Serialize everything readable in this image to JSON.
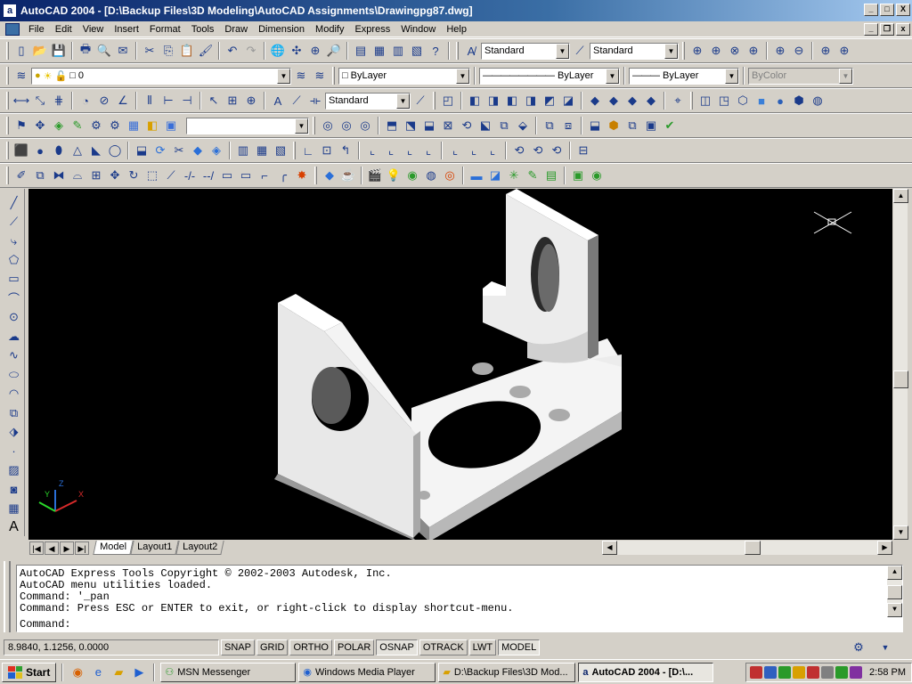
{
  "window": {
    "title": "AutoCAD 2004 - [D:\\Backup Files\\3D Modeling\\AutoCAD Assignments\\Drawingpg87.dwg]",
    "controls": [
      "_",
      "□",
      "X"
    ]
  },
  "menubar": {
    "items": [
      "File",
      "Edit",
      "View",
      "Insert",
      "Format",
      "Tools",
      "Draw",
      "Dimension",
      "Modify",
      "Express",
      "Window",
      "Help"
    ]
  },
  "toolbars": {
    "text_style": "Standard",
    "dim_style": "Standard",
    "layer": "0",
    "color": "ByLayer",
    "linetype": "ByLayer",
    "lineweight": "ByLayer",
    "plotstyle": "ByColor",
    "dim_style_2": "Standard",
    "blank_combo": ""
  },
  "tabs": {
    "items": [
      "Model",
      "Layout1",
      "Layout2"
    ],
    "active": "Model"
  },
  "ucs_icon": {
    "x": "X",
    "y": "Y",
    "z": "Z"
  },
  "command": {
    "history": [
      "AutoCAD Express Tools Copyright © 2002-2003 Autodesk, Inc.",
      "AutoCAD menu utilities loaded.",
      "Command: '_pan",
      "Command: Press ESC or ENTER to exit, or right-click to display shortcut-menu."
    ],
    "prompt": "Command:"
  },
  "status": {
    "coords": "8.9840, 1.1256, 0.0000",
    "toggles": [
      {
        "label": "SNAP",
        "on": false
      },
      {
        "label": "GRID",
        "on": false
      },
      {
        "label": "ORTHO",
        "on": false
      },
      {
        "label": "POLAR",
        "on": false
      },
      {
        "label": "OSNAP",
        "on": true
      },
      {
        "label": "OTRACK",
        "on": false
      },
      {
        "label": "LWT",
        "on": false
      },
      {
        "label": "MODEL",
        "on": true
      }
    ]
  },
  "taskbar": {
    "start": "Start",
    "tasks": [
      {
        "label": "MSN Messenger",
        "icon": "msn-icon",
        "active": false
      },
      {
        "label": "Windows Media Player",
        "icon": "media-player-icon",
        "active": false
      },
      {
        "label": "D:\\Backup Files\\3D Mod...",
        "icon": "folder-icon",
        "active": false
      },
      {
        "label": "AutoCAD 2004 - [D:\\...",
        "icon": "autocad-icon",
        "active": true
      }
    ],
    "clock": "2:58 PM"
  },
  "colors": {
    "titlebar": "#0a246a",
    "viewport_bg": "#000000",
    "part_light": "#f2f2f2",
    "part_shade": "#9a9a9a"
  }
}
